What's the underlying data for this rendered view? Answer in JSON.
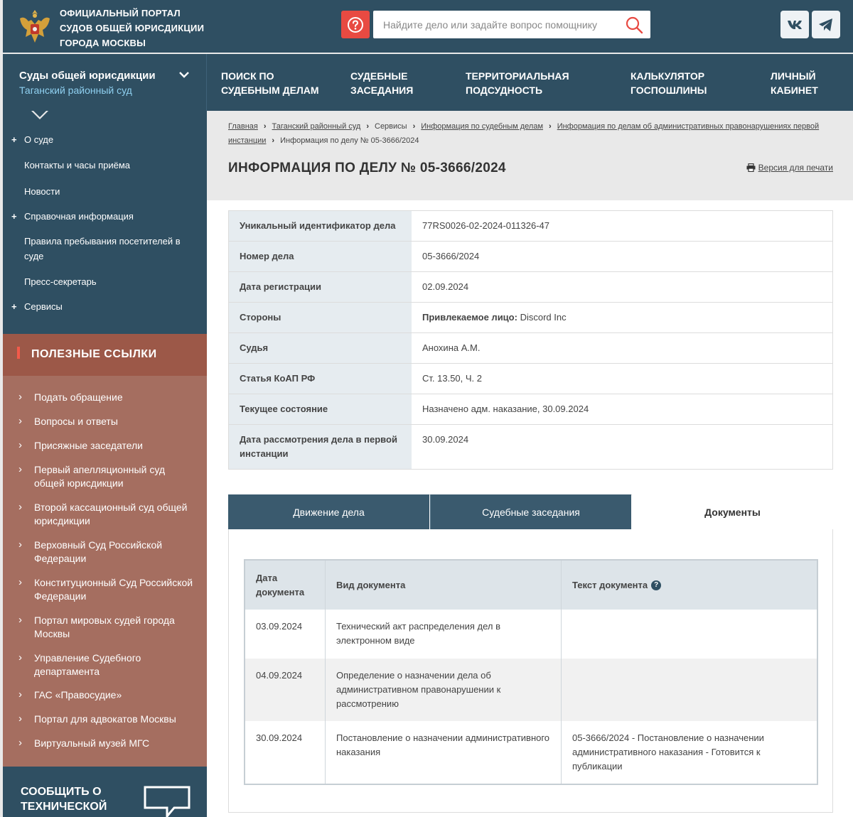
{
  "header": {
    "portal_title_lines": [
      "Официальный портал",
      "судов общей юрисдикции",
      "города Москвы"
    ],
    "search_placeholder": "Найдите дело или задайте вопрос помощнику",
    "social": [
      "vk-icon",
      "telegram-icon"
    ]
  },
  "nav": {
    "court_line1": "Суды общей юрисдикции",
    "court_line2": "Таганский районный суд",
    "items": [
      {
        "l1": "Поиск по",
        "l2": "судебным делам"
      },
      {
        "l1": "Судебные",
        "l2": "заседания"
      },
      {
        "l1": "Территориальная",
        "l2": "подсудность"
      },
      {
        "l1": "Калькулятор",
        "l2": "госпошлины"
      },
      {
        "l1": "Личный",
        "l2": "кабинет"
      }
    ]
  },
  "sidebar": {
    "menu": [
      {
        "label": "О суде",
        "plus": "+"
      },
      {
        "label": "Контакты и часы приёма",
        "plus": ""
      },
      {
        "label": "Новости",
        "plus": ""
      },
      {
        "label": "Справочная информация",
        "plus": "+"
      },
      {
        "label": "Правила пребывания посетителей в суде",
        "plus": ""
      },
      {
        "label": "Пресс-секретарь",
        "plus": ""
      },
      {
        "label": "Сервисы",
        "plus": "+"
      }
    ],
    "useful_title": "Полезные ссылки",
    "useful_links": [
      "Подать обращение",
      "Вопросы и ответы",
      "Присяжные заседатели",
      "Первый апелляционный суд общей юрисдикции",
      "Второй кассационный суд общей юрисдикции",
      "Верховный Суд Российской Федерации",
      "Конституционный Суд Российской Федерации",
      "Портал мировых судей города Москвы",
      "Управление Судебного департамента",
      "ГАС «Правосудие»",
      "Портал для адвокатов Москвы",
      "Виртуальный музей МГС"
    ],
    "report_line1": "Сообщить о",
    "report_line2": "технической"
  },
  "breadcrumbs": {
    "items": [
      {
        "label": "Главная",
        "link": true
      },
      {
        "label": "Таганский районный суд",
        "link": true
      },
      {
        "label": "Сервисы",
        "link": false
      },
      {
        "label": "Информация по судебным делам",
        "link": true
      },
      {
        "label": "Информация по делам об административных правонарушениях первой инстанции",
        "link": true
      },
      {
        "label": "Информация по делу № 05-3666/2024",
        "link": false
      }
    ]
  },
  "page": {
    "title": "Информация по делу № 05-3666/2024",
    "print_label": "Версия для печати"
  },
  "case_info": [
    {
      "label": "Уникальный идентификатор дела",
      "value": "77RS0026-02-2024-011326-47",
      "bold_prefix": ""
    },
    {
      "label": "Номер дела",
      "value": "05-3666/2024",
      "bold_prefix": ""
    },
    {
      "label": "Дата регистрации",
      "value": "02.09.2024",
      "bold_prefix": ""
    },
    {
      "label": "Стороны",
      "value": "Discord Inc",
      "bold_prefix": "Привлекаемое лицо:"
    },
    {
      "label": "Судья",
      "value": "Анохина А.М.",
      "bold_prefix": ""
    },
    {
      "label": "Статья КоАП РФ",
      "value": "Ст. 13.50, Ч. 2",
      "bold_prefix": ""
    },
    {
      "label": "Текущее состояние",
      "value": "Назначено адм. наказание, 30.09.2024",
      "bold_prefix": ""
    },
    {
      "label": "Дата рассмотрения дела в первой инстанции",
      "value": "30.09.2024",
      "bold_prefix": ""
    }
  ],
  "tabs": [
    {
      "label": "Движение дела",
      "active": false
    },
    {
      "label": "Судебные заседания",
      "active": false
    },
    {
      "label": "Документы",
      "active": true
    }
  ],
  "documents": {
    "headers": [
      "Дата документа",
      "Вид документа",
      "Текст документа"
    ],
    "rows": [
      {
        "date": "03.09.2024",
        "type": "Технический акт распределения дел в электронном виде",
        "text": ""
      },
      {
        "date": "04.09.2024",
        "type": "Определение о назначении дела об административном правонарушении к рассмотрению",
        "text": ""
      },
      {
        "date": "30.09.2024",
        "type": "Постановление о назначении административного наказания",
        "text": "05-3666/2024 - Постановление о назначении административного наказания - Готовится к публикации"
      }
    ]
  },
  "colors": {
    "header_bg": "#2f4f62",
    "accent_red": "#e84a42",
    "useful_bg": "#a56e60",
    "useful_head_bg": "#9c5848",
    "link_blue": "#8fd0f0"
  }
}
